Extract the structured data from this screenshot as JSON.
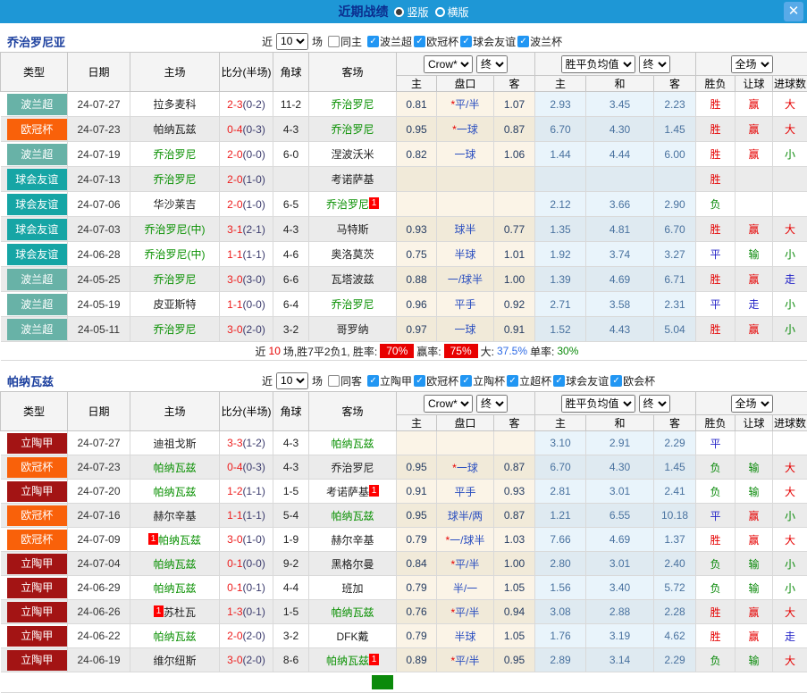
{
  "titlebar": {
    "title": "近期战绩",
    "radio_portrait": "竖版",
    "radio_landscape": "横版",
    "close_label": "✕"
  },
  "columns": {
    "type": "类型",
    "date": "日期",
    "home": "主场",
    "score": "比分(半场)",
    "corner": "角球",
    "away": "客场",
    "sub": [
      "主",
      "盘口",
      "客",
      "主",
      "和",
      "客",
      "胜负",
      "让球",
      "进球数"
    ],
    "selects": {
      "crow": "Crow*",
      "final": "终",
      "avg": "胜平负均值",
      "full": "全场"
    }
  },
  "maps": {
    "league_colors": {
      "波兰超": "#68b2a7",
      "欧冠杯": "#f9610a",
      "球会友谊": "#16a5a5",
      "立陶甲": "#a31414"
    },
    "result_colors": {
      "胜": "r",
      "平": "bl",
      "负": "g",
      "赢": "r",
      "输": "g",
      "走": "bl",
      "大": "r",
      "小": "g"
    }
  },
  "sections": [
    {
      "team": "乔治罗尼亚",
      "filters": {
        "near_label": "近",
        "near_value": "10",
        "games_label": "场",
        "same_label": "同主",
        "leagues": [
          "波兰超",
          "欧冠杯",
          "球会友谊",
          "波兰杯"
        ]
      },
      "rows": [
        {
          "league": "波兰超",
          "date": "24-07-27",
          "home": {
            "name": "拉多麦科"
          },
          "score": "2-3",
          "half": "(0-2)",
          "corner": "11-2",
          "away": {
            "name": "乔治罗尼",
            "green": true
          },
          "star": true,
          "crow": [
            "0.81",
            "平/半",
            "1.07"
          ],
          "avg": [
            "2.93",
            "3.45",
            "2.23"
          ],
          "results": [
            "胜",
            "赢",
            "大"
          ]
        },
        {
          "league": "欧冠杯",
          "date": "24-07-23",
          "home": {
            "name": "帕纳瓦兹"
          },
          "score": "0-4",
          "half": "(0-3)",
          "corner": "4-3",
          "away": {
            "name": "乔治罗尼",
            "green": true
          },
          "star": true,
          "crow": [
            "0.95",
            "一球",
            "0.87"
          ],
          "avg": [
            "6.70",
            "4.30",
            "1.45"
          ],
          "results": [
            "胜",
            "赢",
            "大"
          ]
        },
        {
          "league": "波兰超",
          "date": "24-07-19",
          "home": {
            "name": "乔治罗尼",
            "green": true
          },
          "score": "2-0",
          "half": "(0-0)",
          "corner": "6-0",
          "away": {
            "name": "涅波沃米"
          },
          "star": false,
          "crow": [
            "0.82",
            "一球",
            "1.06"
          ],
          "avg": [
            "1.44",
            "4.44",
            "6.00"
          ],
          "results": [
            "胜",
            "赢",
            "小"
          ]
        },
        {
          "league": "球会友谊",
          "date": "24-07-13",
          "home": {
            "name": "乔治罗尼",
            "green": true
          },
          "score": "2-0",
          "half": "(1-0)",
          "corner": "",
          "away": {
            "name": "考诺萨基"
          },
          "star": false,
          "crow": [
            "",
            "",
            ""
          ],
          "avg": [
            "",
            "",
            ""
          ],
          "results": [
            "胜",
            "",
            ""
          ]
        },
        {
          "league": "球会友谊",
          "date": "24-07-06",
          "home": {
            "name": "华沙莱吉"
          },
          "score": "2-0",
          "half": "(1-0)",
          "corner": "6-5",
          "away": {
            "name": "乔治罗尼",
            "green": true,
            "badge": "after"
          },
          "star": false,
          "crow": [
            "",
            "",
            ""
          ],
          "avg": [
            "2.12",
            "3.66",
            "2.90"
          ],
          "results": [
            "负",
            "",
            ""
          ]
        },
        {
          "league": "球会友谊",
          "date": "24-07-03",
          "home": {
            "name": "乔治罗尼(中)",
            "green": true
          },
          "score": "3-1",
          "half": "(2-1)",
          "corner": "4-3",
          "away": {
            "name": "马特斯"
          },
          "star": false,
          "crow": [
            "0.93",
            "球半",
            "0.77"
          ],
          "avg": [
            "1.35",
            "4.81",
            "6.70"
          ],
          "results": [
            "胜",
            "赢",
            "大"
          ]
        },
        {
          "league": "球会友谊",
          "date": "24-06-28",
          "home": {
            "name": "乔治罗尼(中)",
            "green": true
          },
          "score": "1-1",
          "half": "(1-1)",
          "corner": "4-6",
          "away": {
            "name": "奥洛莫茨"
          },
          "star": false,
          "crow": [
            "0.75",
            "半球",
            "1.01"
          ],
          "avg": [
            "1.92",
            "3.74",
            "3.27"
          ],
          "results": [
            "平",
            "输",
            "小"
          ]
        },
        {
          "league": "波兰超",
          "date": "24-05-25",
          "home": {
            "name": "乔治罗尼",
            "green": true
          },
          "score": "3-0",
          "half": "(3-0)",
          "corner": "6-6",
          "away": {
            "name": "瓦塔波兹"
          },
          "star": false,
          "crow": [
            "0.88",
            "一/球半",
            "1.00"
          ],
          "avg": [
            "1.39",
            "4.69",
            "6.71"
          ],
          "results": [
            "胜",
            "赢",
            "走"
          ]
        },
        {
          "league": "波兰超",
          "date": "24-05-19",
          "home": {
            "name": "皮亚斯特"
          },
          "score": "1-1",
          "half": "(0-0)",
          "corner": "6-4",
          "away": {
            "name": "乔治罗尼",
            "green": true
          },
          "star": false,
          "crow": [
            "0.96",
            "平手",
            "0.92"
          ],
          "avg": [
            "2.71",
            "3.58",
            "2.31"
          ],
          "results": [
            "平",
            "走",
            "小"
          ]
        },
        {
          "league": "波兰超",
          "date": "24-05-11",
          "home": {
            "name": "乔治罗尼",
            "green": true
          },
          "score": "3-0",
          "half": "(2-0)",
          "corner": "3-2",
          "away": {
            "name": "哥罗纳"
          },
          "star": false,
          "crow": [
            "0.97",
            "一球",
            "0.91"
          ],
          "avg": [
            "1.52",
            "4.43",
            "5.04"
          ],
          "results": [
            "胜",
            "赢",
            "小"
          ]
        }
      ],
      "summary": {
        "p1": "近",
        "count": "10",
        "p2": "场,胜7平2负1, 胜率:",
        "rate": "70%",
        "p3": "赢率:",
        "rate2": "75%",
        "p4": "大:",
        "big": "37.5%",
        "p5": "单率:",
        "single": "30%"
      }
    },
    {
      "team": "帕纳瓦兹",
      "filters": {
        "near_label": "近",
        "near_value": "10",
        "games_label": "场",
        "same_label": "同客",
        "leagues": [
          "立陶甲",
          "欧冠杯",
          "立陶杯",
          "立超杯",
          "球会友谊",
          "欧会杯"
        ]
      },
      "rows": [
        {
          "league": "立陶甲",
          "date": "24-07-27",
          "home": {
            "name": "迪祖戈斯"
          },
          "score": "3-3",
          "half": "(1-2)",
          "corner": "4-3",
          "away": {
            "name": "帕纳瓦兹",
            "green": true
          },
          "star": false,
          "crow": [
            "",
            "",
            ""
          ],
          "avg": [
            "3.10",
            "2.91",
            "2.29"
          ],
          "results": [
            "平",
            "",
            ""
          ]
        },
        {
          "league": "欧冠杯",
          "date": "24-07-23",
          "home": {
            "name": "帕纳瓦兹",
            "green": true
          },
          "score": "0-4",
          "half": "(0-3)",
          "corner": "4-3",
          "away": {
            "name": "乔治罗尼"
          },
          "star": true,
          "crow": [
            "0.95",
            "一球",
            "0.87"
          ],
          "avg": [
            "6.70",
            "4.30",
            "1.45"
          ],
          "results": [
            "负",
            "输",
            "大"
          ]
        },
        {
          "league": "立陶甲",
          "date": "24-07-20",
          "home": {
            "name": "帕纳瓦兹",
            "green": true
          },
          "score": "1-2",
          "half": "(1-1)",
          "corner": "1-5",
          "away": {
            "name": "考诺萨基",
            "badge": "after"
          },
          "star": false,
          "crow": [
            "0.91",
            "平手",
            "0.93"
          ],
          "avg": [
            "2.81",
            "3.01",
            "2.41"
          ],
          "results": [
            "负",
            "输",
            "大"
          ]
        },
        {
          "league": "欧冠杯",
          "date": "24-07-16",
          "home": {
            "name": "赫尔辛基"
          },
          "score": "1-1",
          "half": "(1-1)",
          "corner": "5-4",
          "away": {
            "name": "帕纳瓦兹",
            "green": true
          },
          "star": false,
          "crow": [
            "0.95",
            "球半/两",
            "0.87"
          ],
          "avg": [
            "1.21",
            "6.55",
            "10.18"
          ],
          "results": [
            "平",
            "赢",
            "小"
          ]
        },
        {
          "league": "欧冠杯",
          "date": "24-07-09",
          "home": {
            "name": "帕纳瓦兹",
            "green": true,
            "badge": "before"
          },
          "score": "3-0",
          "half": "(1-0)",
          "corner": "1-9",
          "away": {
            "name": "赫尔辛基"
          },
          "star": true,
          "crow": [
            "0.79",
            "一/球半",
            "1.03"
          ],
          "avg": [
            "7.66",
            "4.69",
            "1.37"
          ],
          "results": [
            "胜",
            "赢",
            "大"
          ]
        },
        {
          "league": "立陶甲",
          "date": "24-07-04",
          "home": {
            "name": "帕纳瓦兹",
            "green": true
          },
          "score": "0-1",
          "half": "(0-0)",
          "corner": "9-2",
          "away": {
            "name": "黑格尔曼"
          },
          "star": true,
          "crow": [
            "0.84",
            "平/半",
            "1.00"
          ],
          "avg": [
            "2.80",
            "3.01",
            "2.40"
          ],
          "results": [
            "负",
            "输",
            "小"
          ]
        },
        {
          "league": "立陶甲",
          "date": "24-06-29",
          "home": {
            "name": "帕纳瓦兹",
            "green": true
          },
          "score": "0-1",
          "half": "(0-1)",
          "corner": "4-4",
          "away": {
            "name": "班加"
          },
          "star": false,
          "crow": [
            "0.79",
            "半/一",
            "1.05"
          ],
          "avg": [
            "1.56",
            "3.40",
            "5.72"
          ],
          "results": [
            "负",
            "输",
            "小"
          ]
        },
        {
          "league": "立陶甲",
          "date": "24-06-26",
          "home": {
            "name": "苏杜瓦",
            "badge": "before"
          },
          "score": "1-3",
          "half": "(0-1)",
          "corner": "1-5",
          "away": {
            "name": "帕纳瓦兹",
            "green": true
          },
          "star": true,
          "crow": [
            "0.76",
            "平/半",
            "0.94"
          ],
          "avg": [
            "3.08",
            "2.88",
            "2.28"
          ],
          "results": [
            "胜",
            "赢",
            "大"
          ]
        },
        {
          "league": "立陶甲",
          "date": "24-06-22",
          "home": {
            "name": "帕纳瓦兹",
            "green": true
          },
          "score": "2-0",
          "half": "(2-0)",
          "corner": "3-2",
          "away": {
            "name": "DFK戴"
          },
          "star": false,
          "crow": [
            "0.79",
            "半球",
            "1.05"
          ],
          "avg": [
            "1.76",
            "3.19",
            "4.62"
          ],
          "results": [
            "胜",
            "赢",
            "走"
          ]
        },
        {
          "league": "立陶甲",
          "date": "24-06-19",
          "home": {
            "name": "维尔纽斯"
          },
          "score": "3-0",
          "half": "(2-0)",
          "corner": "8-6",
          "away": {
            "name": "帕纳瓦兹",
            "green": true,
            "badge": "after"
          },
          "star": true,
          "crow": [
            "0.89",
            "平/半",
            "0.95"
          ],
          "avg": [
            "2.89",
            "3.14",
            "2.29"
          ],
          "results": [
            "负",
            "输",
            "大"
          ]
        }
      ],
      "summary_partial": {
        "badge_text": ""
      }
    }
  ]
}
